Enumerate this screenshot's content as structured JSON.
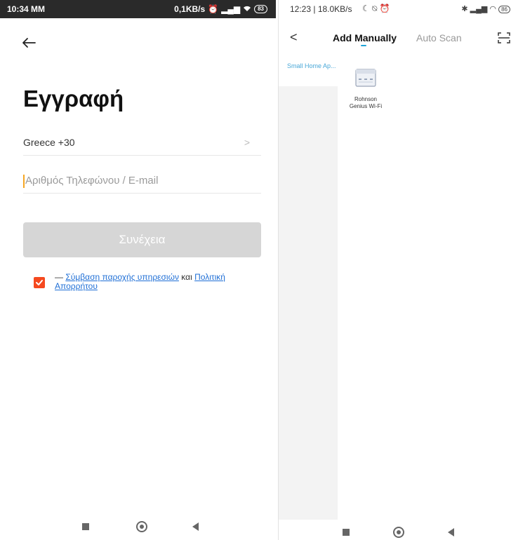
{
  "left": {
    "status": {
      "time": "10:34 MM",
      "speed": "0,1KB/s",
      "battery": "83"
    },
    "title": "Εγγραφή",
    "country": "Greece +30",
    "chevron": ">",
    "phone_placeholder": "Αριθμός Τηλεφώνου / E-mail",
    "continue_label": "Συνέχεια",
    "agree": {
      "prefix": "— ",
      "link1": "Σύμβαση παροχής υπηρεσιών",
      "mid": " και ",
      "link2": "Πολιτική",
      "suffix": "Απορρήτου"
    }
  },
  "right": {
    "status": {
      "time": "12:23 | 18.0KB/s",
      "battery": "86"
    },
    "back": "<",
    "tab_manual": "Add Manually",
    "tab_scan": "Auto Scan",
    "sidebar_items": [
      {
        "label": "Small Home Ap..."
      }
    ],
    "devices": [
      {
        "label": "Rohnson Genius Wi-Fi"
      }
    ]
  },
  "colors": {
    "accent": "#f5491f",
    "link": "#1f6fd6",
    "tab_accent": "#1fa3d6",
    "button_disabled": "#d6d6d6"
  },
  "icons": [
    "back-arrow-icon",
    "checkbox-checked-icon",
    "scan-icon",
    "device-heater-icon",
    "nav-home-icon",
    "nav-back-icon",
    "nav-recents-icon"
  ]
}
